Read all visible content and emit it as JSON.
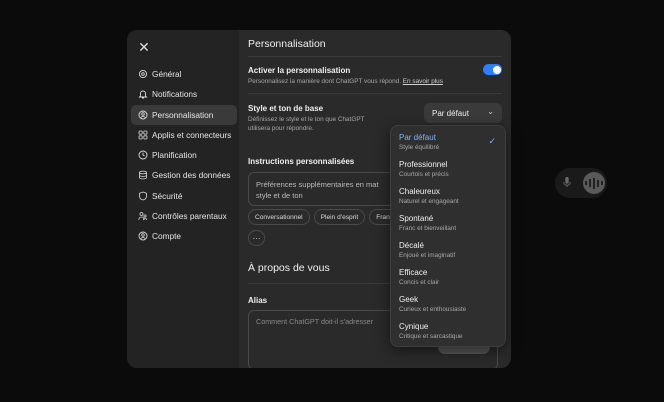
{
  "modal": {
    "close_glyph": "✕",
    "sidebar": {
      "items": [
        {
          "label": "Général",
          "icon": "gear-icon"
        },
        {
          "label": "Notifications",
          "icon": "bell-icon"
        },
        {
          "label": "Personnalisation",
          "icon": "personalization-icon",
          "active": true
        },
        {
          "label": "Applis et connecteurs",
          "icon": "apps-icon"
        },
        {
          "label": "Planification",
          "icon": "clock-icon"
        },
        {
          "label": "Gestion des données",
          "icon": "database-icon"
        },
        {
          "label": "Sécurité",
          "icon": "shield-icon"
        },
        {
          "label": "Contrôles parentaux",
          "icon": "parental-icon"
        },
        {
          "label": "Compte",
          "icon": "account-icon"
        }
      ]
    },
    "content": {
      "title": "Personnalisation",
      "enable": {
        "label": "Activer la personnalisation",
        "desc": "Personnalisez la manière dont ChatGPT vous répond.",
        "link": "En savoir plus",
        "enabled": true
      },
      "style": {
        "label": "Style et ton de base",
        "desc_line1": "Définissez le style et le ton que ChatGPT",
        "desc_line2": "utilisera pour répondre.",
        "selected": "Par défaut",
        "chevron": "⌄"
      },
      "instructions": {
        "label": "Instructions personnalisées",
        "placeholder_line1": "Préférences supplémentaires en mat",
        "placeholder_line2": "style et de ton",
        "chips": [
          "Conversationnel",
          "Plein d'esprit",
          "Fran"
        ],
        "more": "···"
      },
      "about": {
        "title": "À propos de vous",
        "alias_label": "Alias",
        "alias_placeholder": "Comment ChatGPT doit-il s'adresser"
      }
    }
  },
  "dropdown": {
    "check_glyph": "✓",
    "options": [
      {
        "title": "Par défaut",
        "desc": "Style équilibré",
        "selected": true
      },
      {
        "title": "Professionnel",
        "desc": "Courtois et précis"
      },
      {
        "title": "Chaleureux",
        "desc": "Naturel et engageant"
      },
      {
        "title": "Spontané",
        "desc": "Franc et bienveillant"
      },
      {
        "title": "Décalé",
        "desc": "Enjoué et imaginatif"
      },
      {
        "title": "Efficace",
        "desc": "Concis et clair"
      },
      {
        "title": "Geek",
        "desc": "Curieux et enthousiaste"
      },
      {
        "title": "Cynique",
        "desc": "Critique et sarcastique"
      }
    ]
  },
  "background": {
    "mic_icon": "microphone-icon",
    "voice_icon": "voice-mode-icon"
  },
  "colors": {
    "accent": "#2d7ff9",
    "selected_text": "#7fb2ff",
    "modal_bg": "#2a2a2a",
    "sidebar_bg": "#232323"
  }
}
